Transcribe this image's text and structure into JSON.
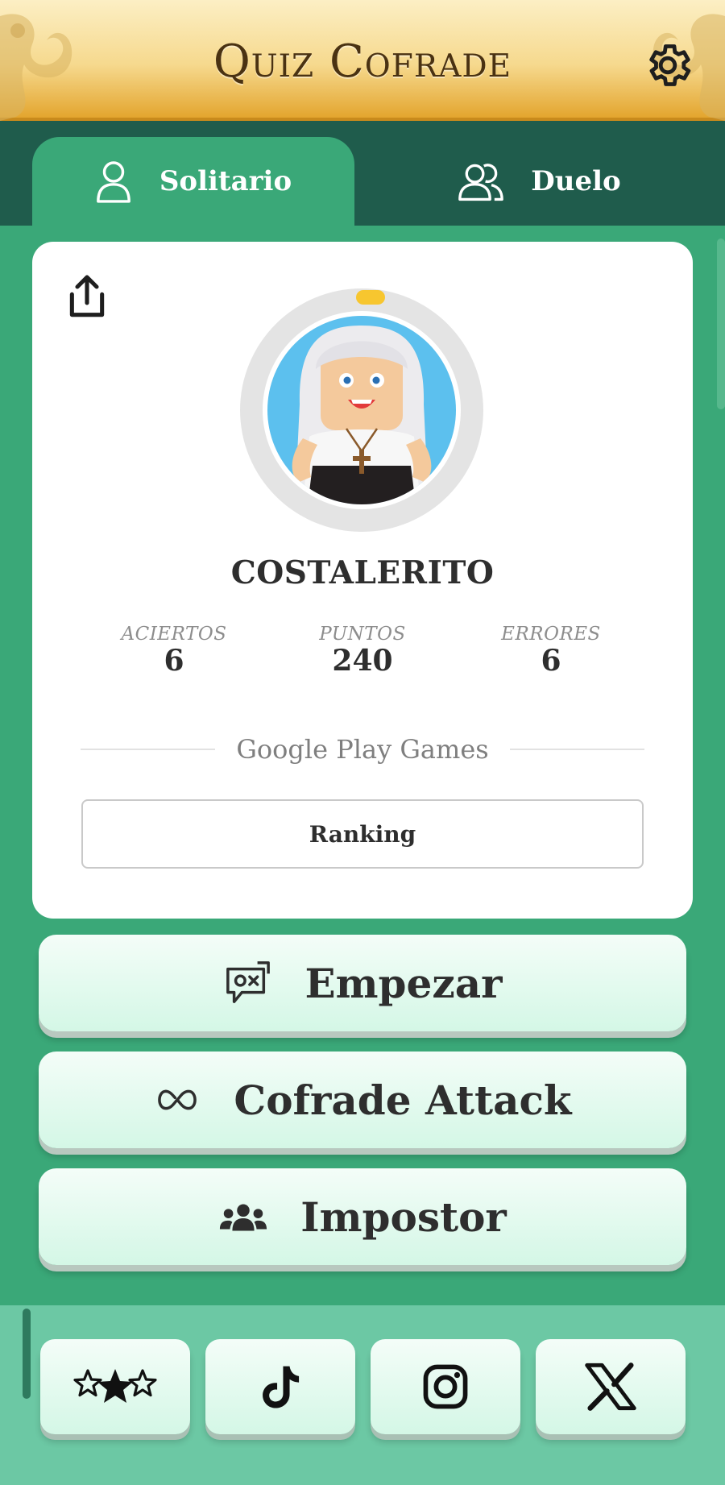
{
  "header": {
    "title": "Quiz Cofrade",
    "settings_icon": "gear-icon"
  },
  "tabs": [
    {
      "label": "Solitario",
      "icon": "user-icon",
      "active": true
    },
    {
      "label": "Duelo",
      "icon": "users-icon",
      "active": false
    }
  ],
  "profile": {
    "share_icon": "share-icon",
    "username": "COSTALERITO",
    "stats": [
      {
        "label": "ACIERTOS",
        "value": "6"
      },
      {
        "label": "PUNTOS",
        "value": "240"
      },
      {
        "label": "ERRORES",
        "value": "6"
      }
    ],
    "section_label": "Google Play Games",
    "ranking_label": "Ranking"
  },
  "actions": [
    {
      "label": "Empezar",
      "icon": "game-controller-icon"
    },
    {
      "label": "Cofrade Attack",
      "icon": "infinity-icon"
    },
    {
      "label": "Impostor",
      "icon": "group-icon"
    }
  ],
  "social": [
    {
      "icon": "stars-icon"
    },
    {
      "icon": "tiktok-icon"
    },
    {
      "icon": "instagram-icon"
    },
    {
      "icon": "x-icon"
    }
  ],
  "colors": {
    "header_gold": "#f6d98e",
    "tab_bar": "#1f5c4c",
    "background_green": "#3aa878",
    "button_mint": "#d4f7e6",
    "bottom_bar": "#6cc8a4"
  }
}
